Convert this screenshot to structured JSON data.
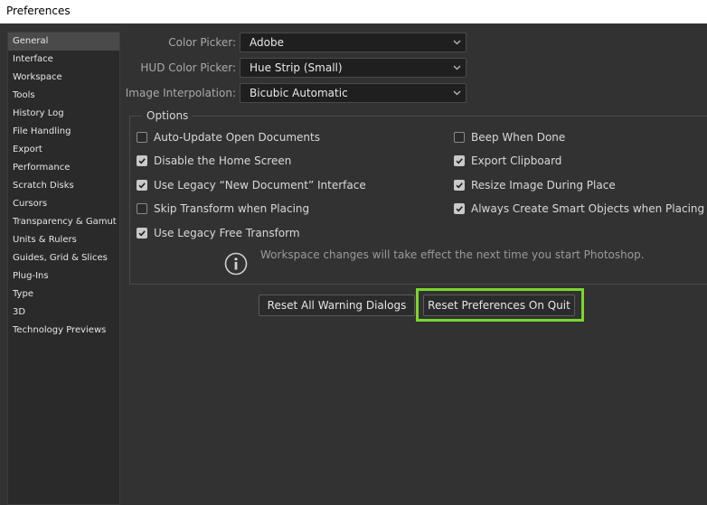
{
  "window": {
    "title": "Preferences"
  },
  "sidebar": {
    "selected": "General",
    "items": [
      "General",
      "Interface",
      "Workspace",
      "Tools",
      "History Log",
      "File Handling",
      "Export",
      "Performance",
      "Scratch Disks",
      "Cursors",
      "Transparency & Gamut",
      "Units & Rulers",
      "Guides, Grid & Slices",
      "Plug-Ins",
      "Type",
      "3D",
      "Technology Previews"
    ]
  },
  "pickers": {
    "color_picker": {
      "label": "Color Picker:",
      "value": "Adobe"
    },
    "hud_color_picker": {
      "label": "HUD Color Picker:",
      "value": "Hue Strip (Small)"
    },
    "image_interpolation": {
      "label": "Image Interpolation:",
      "value": "Bicubic Automatic"
    }
  },
  "options": {
    "title": "Options",
    "auto_update": {
      "label": "Auto-Update Open Documents",
      "checked": false
    },
    "disable_home": {
      "label": "Disable the Home Screen",
      "checked": true
    },
    "legacy_new_doc": {
      "label": "Use Legacy “New Document” Interface",
      "checked": true
    },
    "skip_transform": {
      "label": "Skip Transform when Placing",
      "checked": false
    },
    "legacy_free_transform": {
      "label": "Use Legacy Free Transform",
      "checked": true
    },
    "beep_when_done": {
      "label": "Beep When Done",
      "checked": false
    },
    "export_clipboard": {
      "label": "Export Clipboard",
      "checked": true
    },
    "resize_image": {
      "label": "Resize Image During Place",
      "checked": true
    },
    "smart_objects": {
      "label": "Always Create Smart Objects when Placing",
      "checked": true
    },
    "info_text": "Workspace changes will take effect the next time you start Photoshop."
  },
  "buttons": {
    "reset_warnings": "Reset All Warning Dialogs",
    "reset_prefs": "Reset Preferences On Quit"
  },
  "colors": {
    "highlight": "#7bd62e",
    "background": "#323232"
  },
  "icons": {
    "dropdown": "chevron-down-icon",
    "info": "info-circle-icon",
    "check": "checkmark-icon"
  }
}
